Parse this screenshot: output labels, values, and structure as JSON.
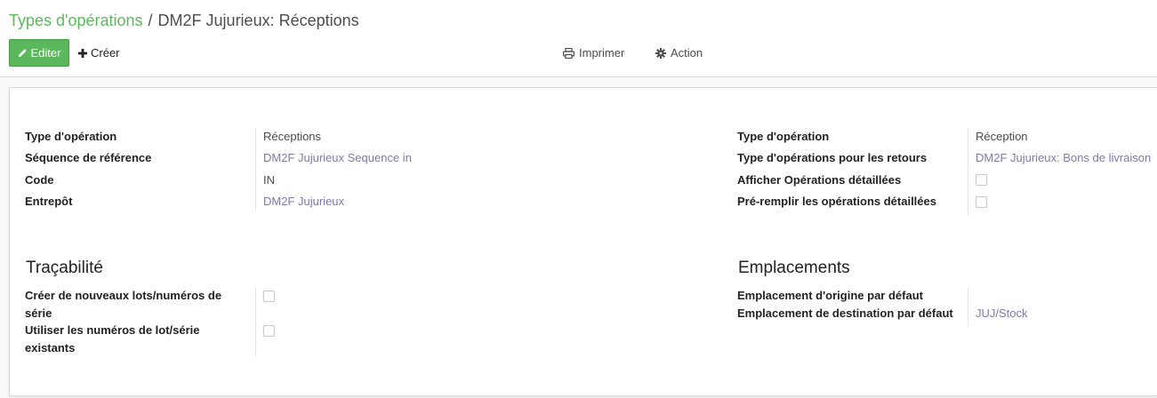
{
  "breadcrumb": {
    "parent": "Types d'opérations",
    "separator": "/",
    "current": "DM2F Jujurieux: Réceptions"
  },
  "toolbar": {
    "edit_label": "Editer",
    "create_label": "Créer",
    "print_label": "Imprimer",
    "action_label": "Action"
  },
  "colors": {
    "primary": "#5cb85c",
    "link": "#7c7bad"
  },
  "form_left": {
    "operation_type_label": "Type d'opération",
    "operation_type_value": "Réceptions",
    "sequence_label": "Séquence de référence",
    "sequence_value": "DM2F Jujurieux Sequence in",
    "code_label": "Code",
    "code_value": "IN",
    "warehouse_label": "Entrepôt",
    "warehouse_value": "DM2F Jujurieux"
  },
  "form_right": {
    "operation_type_label": "Type d'opération",
    "operation_type_value": "Réception",
    "return_type_label": "Type d'opérations pour les retours",
    "return_type_value": "DM2F Jujurieux: Bons de livraison",
    "show_detailed_label": "Afficher Opérations détaillées",
    "show_detailed_checked": false,
    "prefill_detailed_label": "Pré-remplir les opérations détaillées",
    "prefill_detailed_checked": false
  },
  "traceability": {
    "title": "Traçabilité",
    "create_lots_label_line1": "Créer de nouveaux lots/numéros de",
    "create_lots_label_line2": "série",
    "create_lots_checked": false,
    "use_existing_label_line1": "Utiliser les numéros de lot/série",
    "use_existing_label_line2": "existants",
    "use_existing_checked": false
  },
  "locations": {
    "title": "Emplacements",
    "source_label": "Emplacement d'origine par défaut",
    "source_value": "",
    "dest_label": "Emplacement de destination par défaut",
    "dest_value": "JUJ/Stock"
  }
}
